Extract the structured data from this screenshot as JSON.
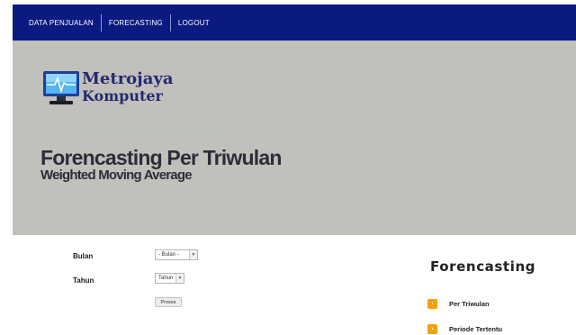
{
  "nav": {
    "items": [
      {
        "label": "DATA PENJUALAN"
      },
      {
        "label": "FORECASTING"
      },
      {
        "label": "LOGOUT"
      }
    ]
  },
  "logo": {
    "line1": "Metrojaya",
    "line2": "Komputer"
  },
  "header": {
    "title": "Forencasting Per Triwulan",
    "subtitle": "Weighted Moving Average"
  },
  "form": {
    "bulan_label": "Bulan",
    "bulan_value": "- Bulan -",
    "tahun_label": "Tahun",
    "tahun_value": "Tahun",
    "submit_label": "Proses"
  },
  "sidebar": {
    "title": "Forencasting",
    "items": [
      {
        "label": "Per Triwulan",
        "icon": "arrow-right-icon"
      },
      {
        "label": "Periode Tertentu",
        "icon": "arrow-right-icon"
      }
    ]
  },
  "colors": {
    "nav_bg": "#0a1a80",
    "banner_bg": "#c1c0ba",
    "logo_text": "#232a72",
    "accent": "#f2a200"
  }
}
